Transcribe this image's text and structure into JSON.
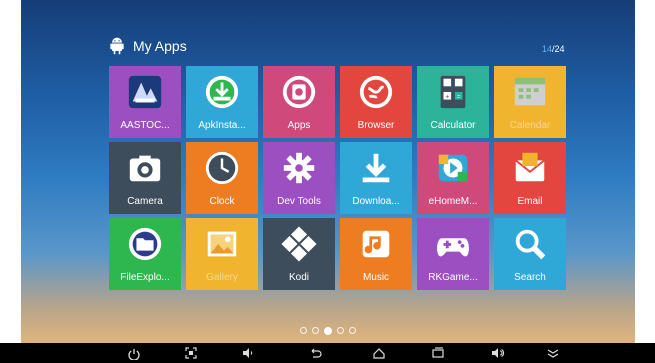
{
  "header": {
    "title": "My Apps",
    "page_current": "14",
    "page_sep": "/",
    "page_total": "24"
  },
  "apps": [
    {
      "label": "AASTOC...",
      "icon": "aastocks-icon",
      "color": "#9b4fc0"
    },
    {
      "label": "ApkInsta...",
      "icon": "apk-installer-icon",
      "color": "#2fa8d8"
    },
    {
      "label": "Apps",
      "icon": "apps-icon",
      "color": "#cf4a7a"
    },
    {
      "label": "Browser",
      "icon": "browser-globe-icon",
      "color": "#e2463e"
    },
    {
      "label": "Calculator",
      "icon": "calculator-icon",
      "color": "#2db39a"
    },
    {
      "label": "Calendar",
      "icon": "calendar-icon",
      "color": "#f1b42e"
    },
    {
      "label": "Camera",
      "icon": "camera-icon",
      "color": "#3e4d5c"
    },
    {
      "label": "Clock",
      "icon": "clock-icon",
      "color": "#ee7d22"
    },
    {
      "label": "Dev Tools",
      "icon": "gear-icon",
      "color": "#9b4fc0"
    },
    {
      "label": "Downloa...",
      "icon": "download-icon",
      "color": "#2fa8d8"
    },
    {
      "label": "eHomeM...",
      "icon": "ehome-media-icon",
      "color": "#cf4a7a"
    },
    {
      "label": "Email",
      "icon": "email-icon",
      "color": "#e2463e"
    },
    {
      "label": "FileExplo...",
      "icon": "folder-icon",
      "color": "#2db74e"
    },
    {
      "label": "Gallery",
      "icon": "gallery-icon",
      "color": "#f1b42e"
    },
    {
      "label": "Kodi",
      "icon": "kodi-icon",
      "color": "#3e4d5c"
    },
    {
      "label": "Music",
      "icon": "music-icon",
      "color": "#ee7d22"
    },
    {
      "label": "RKGame...",
      "icon": "gamepad-icon",
      "color": "#9b4fc0"
    },
    {
      "label": "Search",
      "icon": "search-icon",
      "color": "#2fa8d8"
    }
  ],
  "pager": {
    "count": 5,
    "active": 2
  },
  "navbar": [
    "power-icon",
    "screenshot-icon",
    "volume-down-icon",
    "back-icon",
    "home-icon",
    "recents-icon",
    "volume-up-icon",
    "menu-icon"
  ]
}
